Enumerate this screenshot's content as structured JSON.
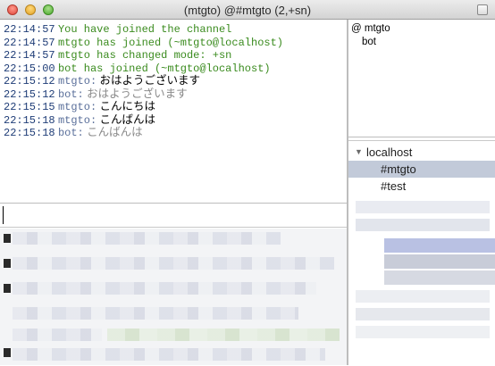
{
  "window": {
    "title": "(mtgto) @#mtgto (2,+sn)"
  },
  "log": [
    {
      "time": "22:14:57",
      "system": "You have joined the channel"
    },
    {
      "time": "22:14:57",
      "system": "mtgto has joined (~mtgto@localhost)"
    },
    {
      "time": "22:14:57",
      "system": "mtgto has changed mode: +sn"
    },
    {
      "time": "22:15:00",
      "system": "bot has joined (~mtgto@localhost)"
    },
    {
      "time": "22:15:12",
      "nick": "mtgto:",
      "text": "おはようございます",
      "from_bot": false
    },
    {
      "time": "22:15:12",
      "nick": "bot:",
      "text": "おはようございます",
      "from_bot": true
    },
    {
      "time": "22:15:15",
      "nick": "mtgto:",
      "text": "こんにちは",
      "from_bot": false
    },
    {
      "time": "22:15:18",
      "nick": "mtgto:",
      "text": "こんばんは",
      "from_bot": false
    },
    {
      "time": "22:15:18",
      "nick": "bot:",
      "text": "こんばんは",
      "from_bot": true
    }
  ],
  "input": {
    "value": ""
  },
  "users": [
    {
      "label": "@ mtgto",
      "operator": true
    },
    {
      "label": "bot",
      "operator": false
    }
  ],
  "servers": [
    {
      "name": "localhost",
      "expanded": true,
      "channels": [
        {
          "name": "#mtgto",
          "selected": true
        },
        {
          "name": "#test",
          "selected": false
        }
      ]
    }
  ],
  "colors": {
    "timestamp": "#1f3d77",
    "system_message": "#3a8b1e",
    "nick": "#5a6f9a",
    "bot_message": "#8a8a8a",
    "selected_channel": "#c2cad9"
  }
}
